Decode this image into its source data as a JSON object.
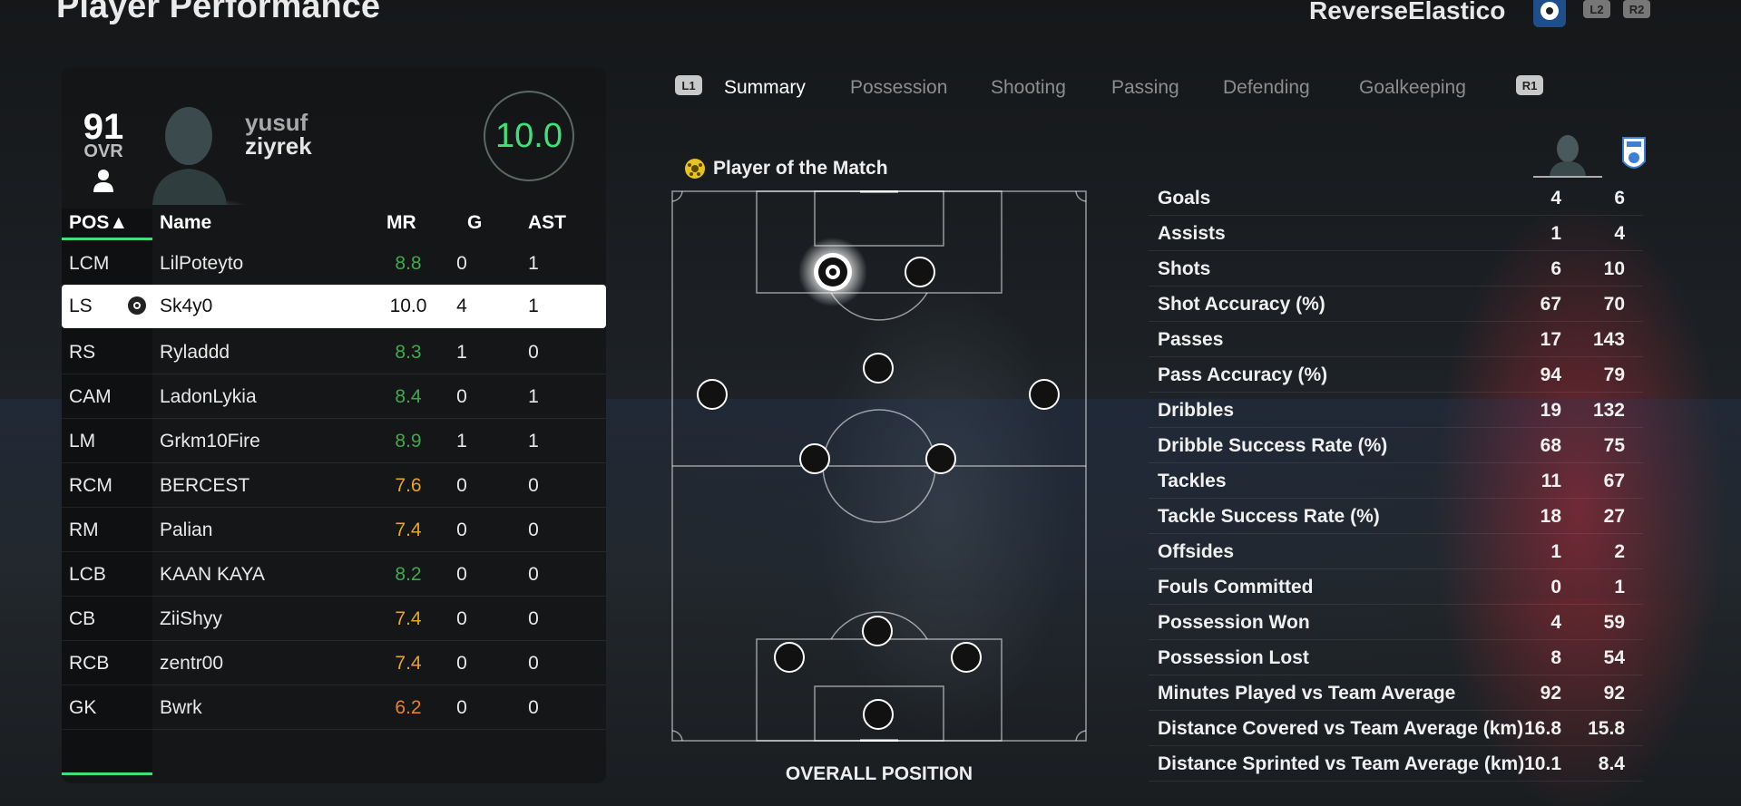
{
  "header": {
    "title": "Player Performance",
    "username": "ReverseElastico",
    "l2": "L2",
    "r2": "R2"
  },
  "player_card": {
    "ovr": "91",
    "ovr_label": "OVR",
    "first_name": "yusuf",
    "last_name": "ziyrek",
    "match_rating": "10.0"
  },
  "roster": {
    "columns": {
      "pos": "POS▲",
      "name": "Name",
      "mr": "MR",
      "g": "G",
      "ast": "AST"
    },
    "rows": [
      {
        "pos": "LCM",
        "name": "LilPoteyto",
        "mr": "8.8",
        "g": "0",
        "ast": "1",
        "mr_color": "#3faa4a"
      },
      {
        "pos": "LS",
        "name": "Sk4y0",
        "mr": "10.0",
        "g": "4",
        "ast": "1",
        "mr_color": "#111111"
      },
      {
        "pos": "RS",
        "name": "Ryladdd",
        "mr": "8.3",
        "g": "1",
        "ast": "0",
        "mr_color": "#3faa4a"
      },
      {
        "pos": "CAM",
        "name": "LadonLykia",
        "mr": "8.4",
        "g": "0",
        "ast": "1",
        "mr_color": "#3faa4a"
      },
      {
        "pos": "LM",
        "name": "Grkm10Fire",
        "mr": "8.9",
        "g": "1",
        "ast": "1",
        "mr_color": "#3faa4a"
      },
      {
        "pos": "RCM",
        "name": "BERCEST",
        "mr": "7.6",
        "g": "0",
        "ast": "0",
        "mr_color": "#e8a521"
      },
      {
        "pos": "RM",
        "name": "Palian",
        "mr": "7.4",
        "g": "0",
        "ast": "0",
        "mr_color": "#e8a521"
      },
      {
        "pos": "LCB",
        "name": "KAAN KAYA",
        "mr": "8.2",
        "g": "0",
        "ast": "0",
        "mr_color": "#3faa4a"
      },
      {
        "pos": "CB",
        "name": "ZiiShyy",
        "mr": "7.4",
        "g": "0",
        "ast": "0",
        "mr_color": "#e8a521"
      },
      {
        "pos": "RCB",
        "name": "zentr00",
        "mr": "7.4",
        "g": "0",
        "ast": "0",
        "mr_color": "#e8a521"
      },
      {
        "pos": "GK",
        "name": "Bwrk",
        "mr": "6.2",
        "g": "0",
        "ast": "0",
        "mr_color": "#e8822a"
      }
    ]
  },
  "tabs": {
    "l1": "L1",
    "r1": "R1",
    "items": [
      "Summary",
      "Possession",
      "Shooting",
      "Passing",
      "Defending",
      "Goalkeeping"
    ],
    "active": "Summary"
  },
  "pitch": {
    "potm_label": "Player of the Match",
    "caption": "OVERALL POSITION"
  },
  "stats": [
    {
      "label": "Goals",
      "player": "4",
      "team": "6"
    },
    {
      "label": "Assists",
      "player": "1",
      "team": "4"
    },
    {
      "label": "Shots",
      "player": "6",
      "team": "10"
    },
    {
      "label": "Shot Accuracy (%)",
      "player": "67",
      "team": "70"
    },
    {
      "label": "Passes",
      "player": "17",
      "team": "143"
    },
    {
      "label": "Pass Accuracy (%)",
      "player": "94",
      "team": "79"
    },
    {
      "label": "Dribbles",
      "player": "19",
      "team": "132"
    },
    {
      "label": "Dribble Success Rate (%)",
      "player": "68",
      "team": "75"
    },
    {
      "label": "Tackles",
      "player": "11",
      "team": "67"
    },
    {
      "label": "Tackle Success Rate (%)",
      "player": "18",
      "team": "27"
    },
    {
      "label": "Offsides",
      "player": "1",
      "team": "2"
    },
    {
      "label": "Fouls Committed",
      "player": "0",
      "team": "1"
    },
    {
      "label": "Possession Won",
      "player": "4",
      "team": "59"
    },
    {
      "label": "Possession Lost",
      "player": "8",
      "team": "54"
    },
    {
      "label": "Minutes Played vs Team Average",
      "player": "92",
      "team": "92"
    },
    {
      "label": "Distance Covered vs Team Average (km)",
      "player": "16.8",
      "team": "15.8"
    },
    {
      "label": "Distance Sprinted vs Team Average (km)",
      "player": "10.1",
      "team": "8.4"
    }
  ],
  "colors": {
    "accent": "#3fe07a",
    "good": "#3faa4a",
    "average": "#e8a521",
    "poor": "#e8822a"
  }
}
